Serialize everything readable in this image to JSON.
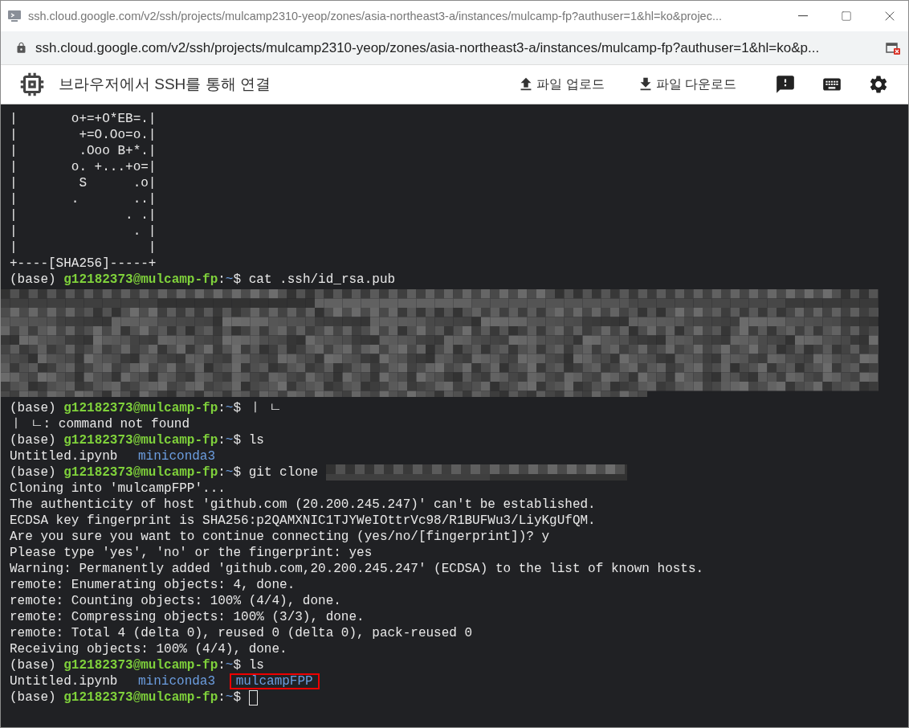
{
  "window": {
    "title": "ssh.cloud.google.com/v2/ssh/projects/mulcamp2310-yeop/zones/asia-northeast3-a/instances/mulcamp-fp?authuser=1&hl=ko&projec..."
  },
  "address_bar": {
    "url": "ssh.cloud.google.com/v2/ssh/projects/mulcamp2310-yeop/zones/asia-northeast3-a/instances/mulcamp-fp?authuser=1&hl=ko&p..."
  },
  "toolbar": {
    "title": "브라우저에서 SSH를 통해 연결",
    "actions": [
      {
        "kind": "upload",
        "label": "파일 업로드"
      },
      {
        "kind": "download",
        "label": "파일 다운로드"
      }
    ],
    "icons": [
      {
        "kind": "feedback"
      },
      {
        "kind": "keyboard"
      },
      {
        "kind": "settings"
      }
    ]
  },
  "terminal": {
    "lines": [
      {
        "kind": "text",
        "text": "|       o+=+O*EB=.|"
      },
      {
        "kind": "text",
        "text": "|        +=O.Oo=o.|"
      },
      {
        "kind": "text",
        "text": "|        .Ooo B+*.|"
      },
      {
        "kind": "text",
        "text": "|       o. +...+o=|"
      },
      {
        "kind": "text",
        "text": "|        S      .o|"
      },
      {
        "kind": "text",
        "text": "|       .       ..|"
      },
      {
        "kind": "text",
        "text": "|              . .|"
      },
      {
        "kind": "text",
        "text": "|               . |"
      },
      {
        "kind": "text",
        "text": "|                 |"
      },
      {
        "kind": "text",
        "text": "+----[SHA256]-----+"
      },
      {
        "kind": "prompt",
        "env": "(base)",
        "host": "g12182373@mulcamp-fp",
        "sep": ":",
        "path": "~",
        "sign": "$",
        "command": "cat .ssh/id_rsa.pub"
      },
      {
        "kind": "redacted"
      },
      {
        "kind": "prompt",
        "env": "(base)",
        "host": "g12182373@mulcamp-fp",
        "sep": ":",
        "path": "~",
        "sign": "$",
        "command": "ㅣ ㄴ"
      },
      {
        "kind": "text",
        "text": "ㅣ ㄴ: command not found"
      },
      {
        "kind": "prompt",
        "env": "(base)",
        "host": "g12182373@mulcamp-fp",
        "sep": ":",
        "path": "~",
        "sign": "$",
        "command": "ls"
      },
      {
        "kind": "listing",
        "items": [
          {
            "text": "Untitled.ipynb",
            "kind": "file",
            "highlighted": false
          },
          {
            "text": "miniconda3",
            "kind": "dir",
            "highlighted": false
          }
        ]
      },
      {
        "kind": "prompt",
        "env": "(base)",
        "host": "g12182373@mulcamp-fp",
        "sep": ":",
        "path": "~",
        "sign": "$",
        "command": "git clone",
        "redacted": true
      },
      {
        "kind": "text",
        "text": "Cloning into 'mulcampFPP'..."
      },
      {
        "kind": "text",
        "text": "The authenticity of host 'github.com (20.200.245.247)' can't be established."
      },
      {
        "kind": "text",
        "text": "ECDSA key fingerprint is SHA256:p2QAMXNIC1TJYWeIOttrVc98/R1BUFWu3/LiyKgUfQM."
      },
      {
        "kind": "text",
        "text": "Are you sure you want to continue connecting (yes/no/[fingerprint])? y"
      },
      {
        "kind": "text",
        "text": "Please type 'yes', 'no' or the fingerprint: yes"
      },
      {
        "kind": "text",
        "text": "Warning: Permanently added 'github.com,20.200.245.247' (ECDSA) to the list of known hosts."
      },
      {
        "kind": "text",
        "text": "remote: Enumerating objects: 4, done."
      },
      {
        "kind": "text",
        "text": "remote: Counting objects: 100% (4/4), done."
      },
      {
        "kind": "text",
        "text": "remote: Compressing objects: 100% (3/3), done."
      },
      {
        "kind": "text",
        "text": "remote: Total 4 (delta 0), reused 0 (delta 0), pack-reused 0"
      },
      {
        "kind": "text",
        "text": "Receiving objects: 100% (4/4), done."
      },
      {
        "kind": "prompt",
        "env": "(base)",
        "host": "g12182373@mulcamp-fp",
        "sep": ":",
        "path": "~",
        "sign": "$",
        "command": "ls"
      },
      {
        "kind": "listing",
        "items": [
          {
            "text": "Untitled.ipynb",
            "kind": "file",
            "highlighted": false
          },
          {
            "text": "miniconda3",
            "kind": "dir",
            "highlighted": false
          },
          {
            "text": "mulcampFPP",
            "kind": "dir",
            "highlighted": true
          }
        ]
      },
      {
        "kind": "prompt",
        "env": "(base)",
        "host": "g12182373@mulcamp-fp",
        "sep": ":",
        "path": "~",
        "sign": "$",
        "cursor": true
      }
    ]
  }
}
